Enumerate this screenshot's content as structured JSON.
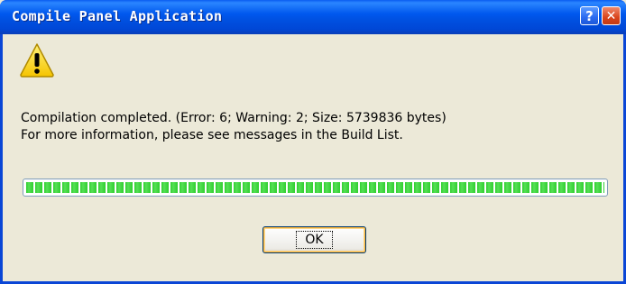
{
  "window": {
    "title": "Compile Panel Application",
    "help_label": "?",
    "close_label": "✕"
  },
  "dialog": {
    "icon": "warning-icon",
    "message_line1": "Compilation completed. (Error: 6; Warning: 2; Size: 5739836 bytes)",
    "message_line2": "For more information, please see messages in the Build List.",
    "progress_percent": 100,
    "ok_label": "OK"
  },
  "colors": {
    "titlebar": "#0058ee",
    "dialog_bg": "#ece9d8",
    "progress": "#2fce2f",
    "warning_yellow": "#ffd400"
  }
}
